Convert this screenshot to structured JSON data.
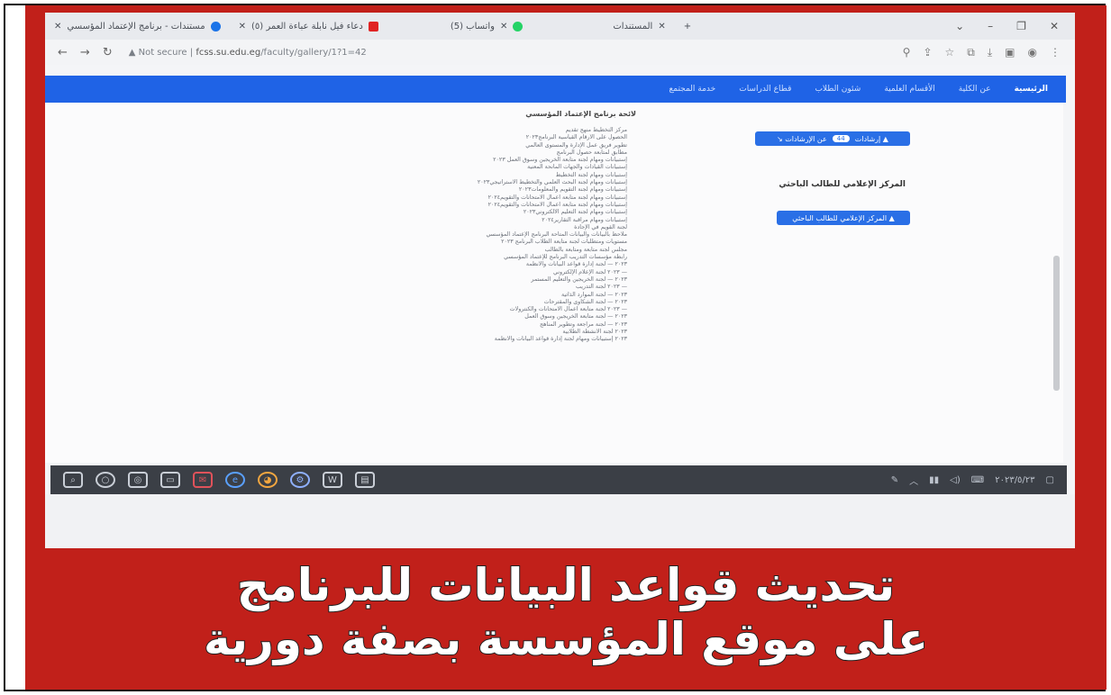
{
  "browser": {
    "tabs": [
      {
        "label": "مستندات - برنامج الإعتماد المؤسسي",
        "color": "#1a73e8"
      },
      {
        "label": "(٥) دعاء فيل نابلة عباءة العمر",
        "color": "#e02424"
      },
      {
        "label": "(5) واتساب",
        "color": "#25d366"
      },
      {
        "label": "المستندات",
        "color": "#777777"
      }
    ],
    "new_tab": "+",
    "window_controls": [
      "⌄",
      "–",
      "❐",
      "✕"
    ],
    "security_label": "Not secure",
    "url_host": "fcss.su.edu.eg",
    "url_path": "/faculty/gallery/1?1=42"
  },
  "site_nav": {
    "items": [
      "الرئيسية",
      "عن الكلية",
      "الأقسام العلمية",
      "شئون الطلاب",
      "قطاع الدراسات",
      "خدمة المجتمع"
    ]
  },
  "right_panel": {
    "button1_label": "▲ إرشادات",
    "button1_badge": "44",
    "button1_tail": "عن الإرشادات ↘",
    "heading": "المركز الإعلامي للطالب الباحثي",
    "button2_label": "▲ المركز الإعلامي للطالب الباحثي"
  },
  "list": {
    "heading": "لائحة برنامج الإعتماد المؤسسي",
    "items": [
      "مركز التخطيط منهج تقديم",
      "الحصول على الأرقام القياسية البرنامج٢٠٢٣",
      "تطوير فريق عمل الإدارة والمستوى العالمي",
      "مطابق لمتابعة حصول البرنامج",
      "إستبيانات ومهام لجنة متابعة الخريجين وسوق العمل ٢٠٢٣",
      "إستبيانات القيادات والجهات المانحة المعنية",
      "إستبيانات ومهام لجنة التخطيط",
      "إستبيانات ومهام لجنة البحث العلمي والتخطيط الاستراتيجي٢٠٢٣",
      "إستبيانات ومهام لجنة التقويم والمعلومات٢٠٢٣",
      "إستبيانات ومهام لجنة متابعة أعمال الامتحانات والتقويم٢٠٢٤",
      "إستبيانات ومهام لجنة متابعة أعمال الامتحانات والتقويم٢٠٢٤",
      "إستبيانات ومهام لجنة التعليم الالكتروني٢٠٢٣",
      "إستبيانات ومهام مراقبة التقارير٢٠٢٤",
      "لجنة القويم في الإجادة",
      "ملاحظ بالبيانات والبيانات المتاحة البرنامج الإعتماد المؤسسي",
      "مستويات ومتطلبات لجنة متابعة الطلاب البرنامج ٢٠٢٣",
      "مجلس لجنة متابعة ومتابعة بالطالب",
      "رابطة مؤسسات التدريب البرنامج للإعتماد المؤسسي",
      "٢٠٢٣ — لجنة إدارة قواعد البيانات والأنظمة",
      "— ٢٠٢٣ لجنة الإعلام الإلكتروني",
      "٢٠٢٣ — لجنة الخريجين والتعليم المستمر",
      "— ٢٠٢٣ لجنة التدريب",
      "٢٠٢٣ — لجنة الموارد الذاتية",
      "٢٠٢٣ — لجنة الشكاوى والمقترحات",
      "— ٢٠٢٣ لجنة متابعة أعمال الامتحانات والكنترولات",
      "٢٠٢٣ — لجنة متابعة الخريجين وسوق العمل",
      "٢٠٢٣ — لجنة مراجعة وتطوير المناهج",
      "٢٠٢٣ لجنة الأنشطة الطلابية",
      "٢٠٢٣ إستبيانات ومهام لجنة إدارة قواعد البيانات والأنظمة"
    ]
  },
  "taskbar": {
    "apps": [
      "search-icon",
      "cortana-icon",
      "folder-icon",
      "mail-icon",
      "edge-icon",
      "chrome-icon",
      "settings-icon",
      "word-icon",
      "explorer-icon"
    ],
    "tray_text": "٢٠٢٣/٥/٢٣"
  },
  "caption": {
    "line1": "تحديث قواعد البيانات للبرنامج",
    "line2": "على موقع المؤسسة بصفة دورية"
  },
  "colors": {
    "frame_red": "#c1201a",
    "nav_blue": "#1f63e6",
    "button_blue": "#2a6fe6",
    "taskbar": "#3b3f46"
  }
}
